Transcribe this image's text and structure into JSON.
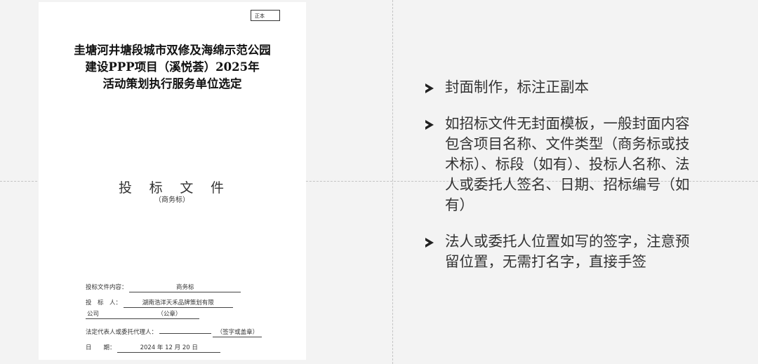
{
  "document": {
    "stamp": "正本",
    "title_lines": [
      "圭塘河井塘段城市双修及海绵示范公园",
      "建设PPP项目（溪悦荟）2025年",
      "活动策划执行服务单位选定"
    ],
    "doc_type_chars": [
      "投",
      "标",
      "文",
      "件"
    ],
    "doc_subtype": "（商务标）",
    "fields": {
      "content_label": "投标文件内容：",
      "content_value": "商务标",
      "bidder_label": "投　标　人：",
      "bidder_value": "湖南浩洋天禾品牌策划有限",
      "bidder_value_cont": "公司",
      "seal_note": "（公章）",
      "rep_label": "法定代表人或委托代理人：",
      "rep_note": "（签字或盖章）",
      "date_label": "日　　期：",
      "date_value": "2024 年  12 月  20 日"
    }
  },
  "notes": [
    "封面制作，标注正副本",
    "如招标文件无封面模板，一般封面内容包含项目名称、文件类型（商务标或技术标）、标段（如有）、投标人名称、法人或委托人签名、日期、招标编号（如有）",
    "法人或委托人位置如写的签字，注意预留位置，无需打名字，直接手签"
  ]
}
